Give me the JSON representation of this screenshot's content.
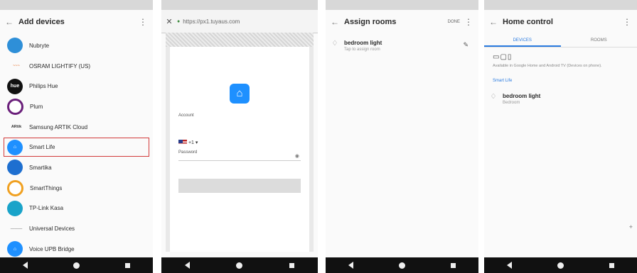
{
  "nav": {
    "back": "◀",
    "home": "●",
    "recent": "■"
  },
  "panel1": {
    "title": "Add devices",
    "devices": [
      {
        "label": "Nubryte",
        "icon": "nubryte-icon",
        "color": "#2e8fd8"
      },
      {
        "label": "OSRAM LIGHTIFY (US)",
        "icon": "osram-icon",
        "color": "#e87a3b"
      },
      {
        "label": "Philips Hue",
        "icon": "philips-hue-icon",
        "color": "#111111"
      },
      {
        "label": "Plum",
        "icon": "plum-icon",
        "color": "#6a1f7a"
      },
      {
        "label": "Samsung ARTIK Cloud",
        "icon": "artik-icon",
        "color": "#333333"
      },
      {
        "label": "Smart Life",
        "icon": "smart-life-icon",
        "color": "#1e90ff",
        "selected": true
      },
      {
        "label": "Smartika",
        "icon": "smartika-icon",
        "color": "#1e6fd0"
      },
      {
        "label": "SmartThings",
        "icon": "smartthings-icon",
        "color": "#f0a020"
      },
      {
        "label": "TP-Link Kasa",
        "icon": "tplink-kasa-icon",
        "color": "#19a3c9"
      },
      {
        "label": "Universal Devices",
        "icon": "universal-devices-icon",
        "color": "#888888"
      },
      {
        "label": "Voice UPB Bridge",
        "icon": "voice-upb-icon",
        "color": "#1e90ff"
      }
    ],
    "selection_color": "#d23a3a"
  },
  "panel2": {
    "url": "https://px1.tuyaus.com",
    "account_label": "Account",
    "password_label": "Password",
    "country_code": "+1",
    "logo_color": "#1e90ff"
  },
  "panel3": {
    "title": "Assign rooms",
    "done": "DONE",
    "device": "bedroom light",
    "device_sub": "Tap to assign room"
  },
  "panel4": {
    "title": "Home control",
    "tabs": [
      "DEVICES",
      "ROOMS"
    ],
    "description": "Available in Google Home and Android TV (Devices on phone).",
    "link": "Smart Life",
    "device": "bedroom light",
    "device_sub": "Bedroom",
    "accent": "#2a7be0"
  }
}
